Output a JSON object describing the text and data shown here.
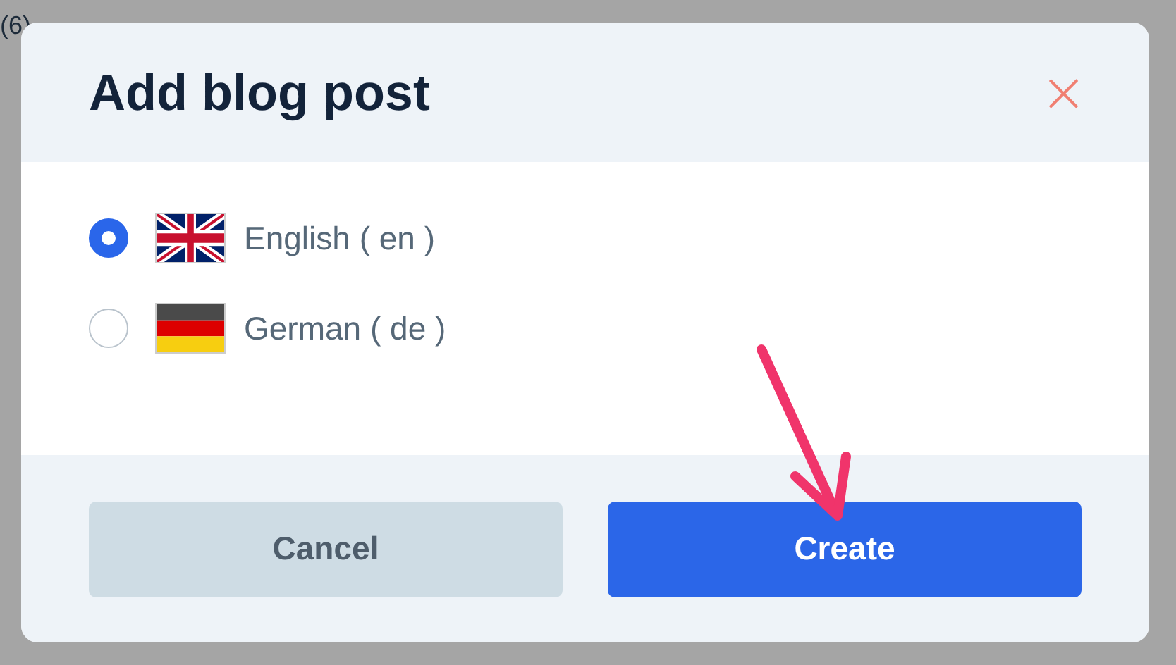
{
  "background": {
    "text": "(6)"
  },
  "dialog": {
    "title": "Add blog post",
    "close": "×",
    "options": [
      {
        "label": "English ( en )",
        "kind": "uk",
        "selected": true
      },
      {
        "label": "German ( de )",
        "kind": "de",
        "selected": false
      }
    ],
    "buttons": [
      {
        "label": "Cancel",
        "kind": "secondary"
      },
      {
        "label": "Create",
        "kind": "primary"
      }
    ]
  }
}
